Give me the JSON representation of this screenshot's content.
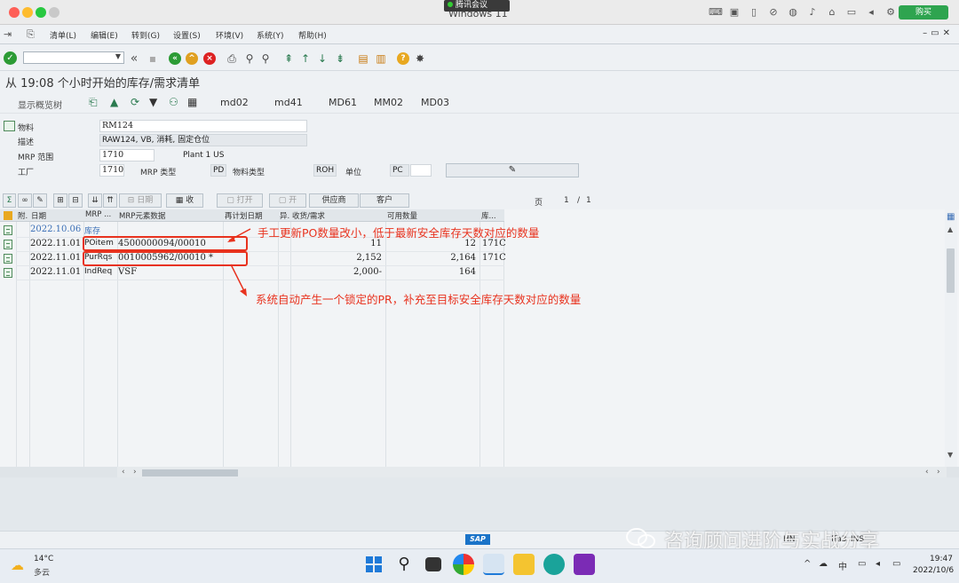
{
  "mac": {
    "window_title": "Windows 11",
    "meeting": "腾讯会议",
    "buy": "购买"
  },
  "menu": [
    "清单(L)",
    "编辑(E)",
    "转到(G)",
    "设置(S)",
    "环境(V)",
    "系统(Y)",
    "帮助(H)"
  ],
  "page_title": "从 19:08 个小时开始的库存/需求清单",
  "app_toolbar": {
    "overview_tree": "显示概览树",
    "links": [
      "md02",
      "md41",
      "MD61",
      "MM02",
      "MD03"
    ]
  },
  "header": {
    "material_label": "物料",
    "material": "RM124",
    "desc_label": "描述",
    "desc": "RAW124, VB, 消耗, 固定仓位",
    "mrp_area_label": "MRP 范围",
    "mrp_area": "1710",
    "mrp_area_name": "Plant 1 US",
    "plant_label": "工厂",
    "plant": "1710",
    "mrp_type_label": "MRP 类型",
    "mrp_type": "PD",
    "mat_type_label": "物料类型",
    "mat_type": "ROH",
    "unit_label": "单位",
    "unit": "PC"
  },
  "grid_toolbar": {
    "date_btn": "日期",
    "receive": "收",
    "open": "打开",
    "open2": "开",
    "vendor": "供应商",
    "customer": "客户",
    "page_label": "页",
    "page": "1",
    "page_sep": "/",
    "page_total": "1"
  },
  "columns": [
    "附.",
    "日期",
    "MRP ...",
    "MRP元素数据",
    "再计划日期",
    "异.",
    "收货/需求",
    "可用数量",
    "库..."
  ],
  "rows": [
    {
      "date": "2022.10.06",
      "element": "库存",
      "data": "",
      "qty": "",
      "avail": "",
      "loc": "",
      "blue": true
    },
    {
      "date": "2022.11.01",
      "element": "POitem",
      "data": "4500000094/00010",
      "qty": "11",
      "avail": "12",
      "loc": "171C"
    },
    {
      "date": "2022.11.01",
      "element": "PurRqs",
      "data": "0010005962/00010 *",
      "qty": "2,152",
      "avail": "2,164",
      "loc": "171C"
    },
    {
      "date": "2022.11.01",
      "element": "IndReq",
      "data": "VSF",
      "qty": "2,000-",
      "avail": "164",
      "loc": ""
    }
  ],
  "annotations": {
    "a1": "手工更新PO数量改小，低于最新安全库存天数对应的数量",
    "a2": "系统自动产生一个锁定的PR，补充至目标安全库存天数对应的数量"
  },
  "status": {
    "left": "HN",
    "right": "ffa3",
    "ins": "INS"
  },
  "watermark": "咨询顾问进阶与实战分享",
  "taskbar": {
    "temp": "14°C",
    "weather": "多云",
    "time": "19:47",
    "date": "2022/10/6"
  },
  "colors": {
    "accent_red": "#e8321e",
    "sap_bg": "#eef1f4",
    "link_blue": "#3b6fb6"
  }
}
